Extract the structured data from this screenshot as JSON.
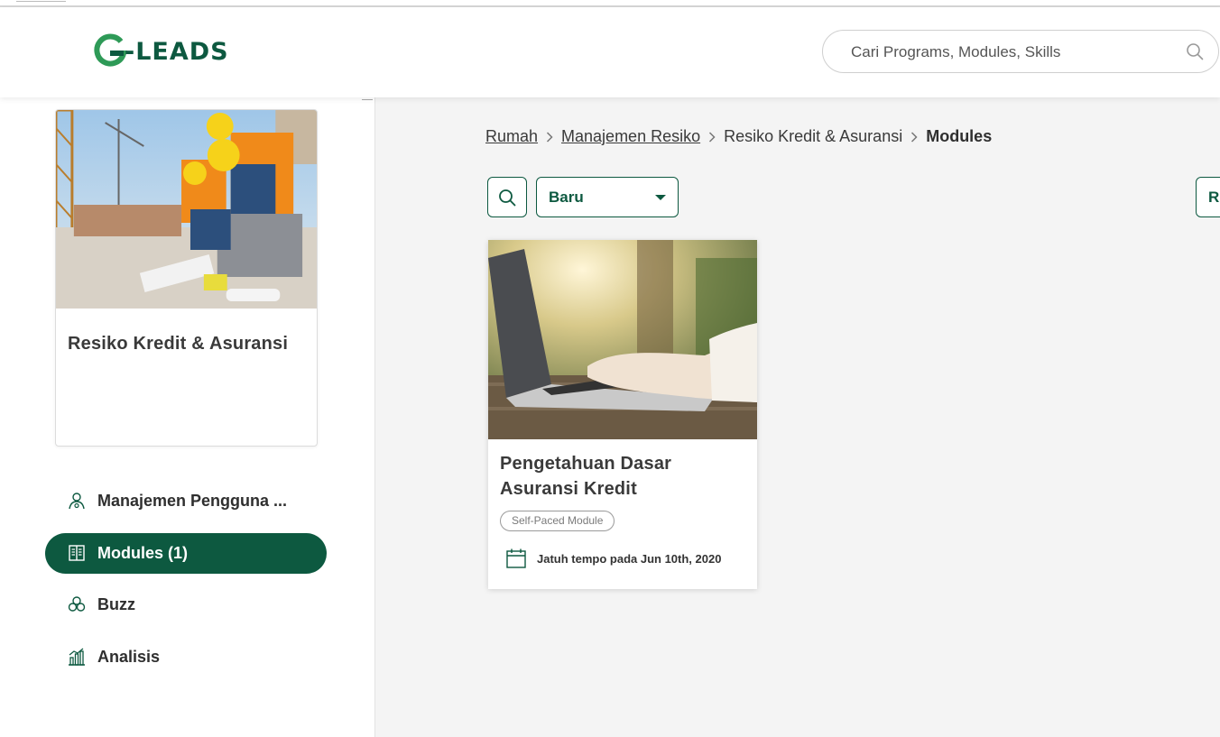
{
  "header": {
    "logo_text": "-LEADS",
    "logo_letter": "G",
    "search_placeholder": "Cari Programs, Modules, Skills"
  },
  "sidebar": {
    "course_title": "Resiko Kredit & Asuransi",
    "items": [
      {
        "label": "Manajemen Pengguna ...",
        "icon": "user-gear-icon",
        "active": false
      },
      {
        "label": "Modules (1)",
        "icon": "book-icon",
        "active": true
      },
      {
        "label": "Buzz",
        "icon": "community-icon",
        "active": false
      },
      {
        "label": "Analisis",
        "icon": "chart-icon",
        "active": false
      }
    ]
  },
  "breadcrumb": {
    "items": [
      "Rumah",
      "Manajemen Resiko",
      "Resiko Kredit & Asuransi"
    ],
    "current": "Modules"
  },
  "toolbar": {
    "sort_value": "Baru",
    "right_button_label": "R"
  },
  "modules": [
    {
      "title": "Pengetahuan Dasar Asuransi Kredit",
      "badge": "Self-Paced Module",
      "due": "Jatuh tempo pada Jun 10th, 2020"
    }
  ],
  "colors": {
    "brand": "#0d5940",
    "background": "#f4f4f4"
  }
}
